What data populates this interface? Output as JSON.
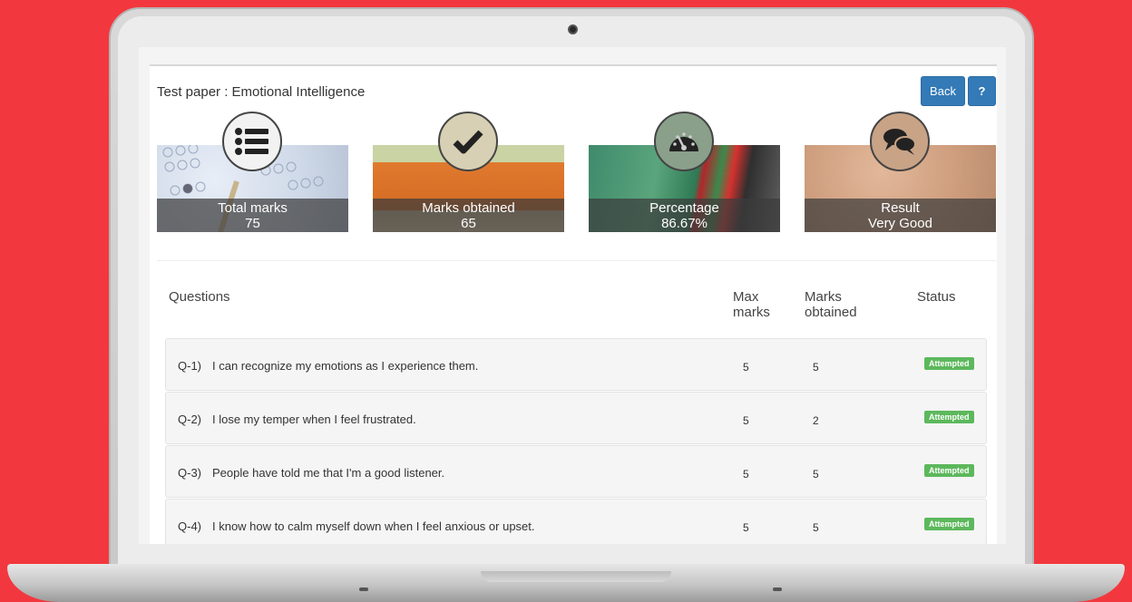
{
  "page": {
    "title": "Test paper : Emotional Intelligence",
    "back_label": "Back",
    "help_label": "?"
  },
  "cards": [
    {
      "label": "Total marks",
      "value": "75",
      "icon": "list-icon"
    },
    {
      "label": "Marks obtained",
      "value": "65",
      "icon": "checkmark-icon"
    },
    {
      "label": "Percentage",
      "value": "86.67%",
      "icon": "gauge-icon"
    },
    {
      "label": "Result",
      "value": "Very Good",
      "icon": "chat-bubbles-icon"
    }
  ],
  "table": {
    "headers": {
      "questions": "Questions",
      "max_line1": "Max",
      "max_line2": "marks",
      "obtained_line1": "Marks",
      "obtained_line2": "obtained",
      "status": "Status"
    },
    "rows": [
      {
        "no": "Q-1)",
        "text": "I can recognize my emotions as I experience them.",
        "max": "5",
        "obtained": "5",
        "status": "Attempted"
      },
      {
        "no": "Q-2)",
        "text": "I lose my temper when I feel frustrated.",
        "max": "5",
        "obtained": "2",
        "status": "Attempted"
      },
      {
        "no": "Q-3)",
        "text": "People have told me that I'm a good listener.",
        "max": "5",
        "obtained": "5",
        "status": "Attempted"
      },
      {
        "no": "Q-4)",
        "text": "I know how to calm myself down when I feel anxious or upset.",
        "max": "5",
        "obtained": "5",
        "status": "Attempted"
      }
    ]
  },
  "colors": {
    "background": "#f2383e",
    "primary_button": "#337ab7",
    "badge": "#5cb85c"
  }
}
